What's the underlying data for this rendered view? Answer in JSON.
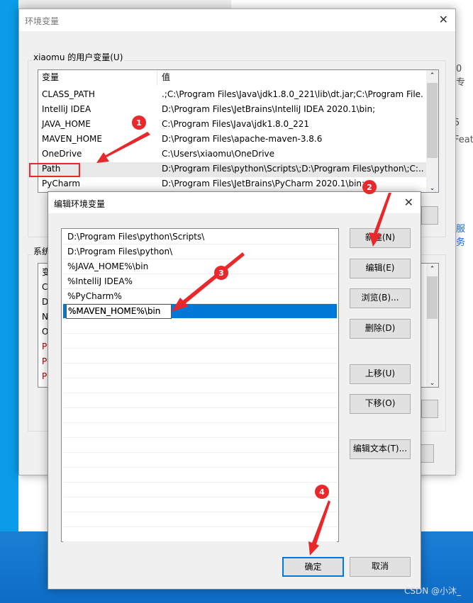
{
  "background": {
    "right_texts": [
      "0 专",
      "5",
      "Featu"
    ],
    "right_link": "服务",
    "watermark": "CSDN @小沐_"
  },
  "outer_dialog": {
    "title": "环境变量",
    "user_group_label": "xiaomu 的用户变量(U)",
    "columns": [
      "变量",
      "值"
    ],
    "rows": [
      {
        "name": "CLASS_PATH",
        "value": ".;C:\\Program Files\\Java\\jdk1.8.0_221\\lib\\dt.jar;C:\\Program File..."
      },
      {
        "name": "IntelliJ IDEA",
        "value": "D:\\Program Files\\JetBrains\\IntelliJ IDEA 2020.1\\bin;"
      },
      {
        "name": "JAVA_HOME",
        "value": "C:\\Program Files\\Java\\jdk1.8.0_221"
      },
      {
        "name": "MAVEN_HOME",
        "value": "D:\\Program Files\\apache-maven-3.8.6"
      },
      {
        "name": "OneDrive",
        "value": "C:\\Users\\xiaomu\\OneDrive"
      },
      {
        "name": "Path",
        "value": "D:\\Program Files\\python\\Scripts\\;D:\\Program Files\\python\\;C:..."
      },
      {
        "name": "PyCharm",
        "value": "D:\\Program Files\\JetBrains\\PyCharm 2020.1\\bin;"
      }
    ],
    "selected_row": "Path",
    "system_group_label": "系统",
    "system_rows_partial": [
      "变",
      "C",
      "D",
      "N",
      "O",
      "P",
      "P",
      "P"
    ]
  },
  "edit_dialog": {
    "title": "编辑环境变量",
    "entries": [
      "D:\\Program Files\\python\\Scripts\\",
      "D:\\Program Files\\python\\",
      "%JAVA_HOME%\\bin",
      "%IntelliJ IDEA%",
      "%PyCharm%",
      "%MAVEN_HOME%\\bin"
    ],
    "editing_entry": "%MAVEN_HOME%\\bin",
    "buttons": {
      "new": "新建(N)",
      "edit": "编辑(E)",
      "browse": "浏览(B)...",
      "delete": "删除(D)",
      "move_up": "上移(U)",
      "move_down": "下移(O)",
      "edit_text": "编辑文本(T)...",
      "ok": "确定",
      "cancel": "取消"
    }
  },
  "annotations": [
    "1",
    "2",
    "3",
    "4"
  ],
  "colors": {
    "accent": "#0078d7",
    "annotation": "#e8282b"
  }
}
